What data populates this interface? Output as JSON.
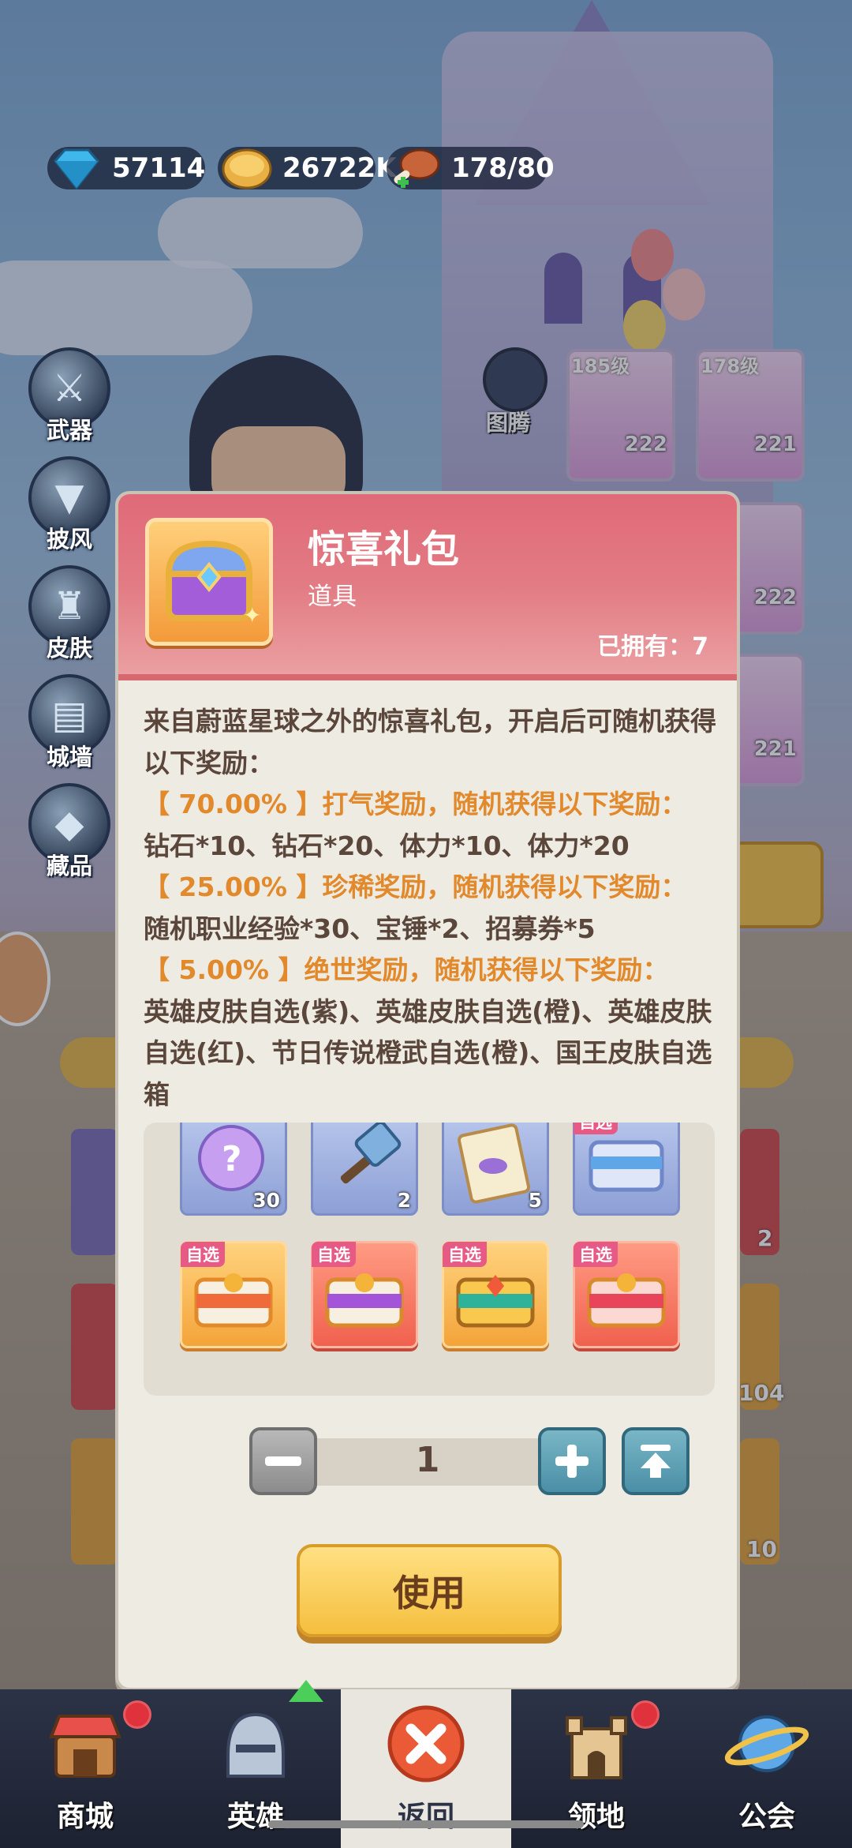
{
  "resources": [
    {
      "icon": "diamond-icon",
      "value": "57114"
    },
    {
      "icon": "coin-icon",
      "value": "26722K"
    },
    {
      "icon": "meat-stamina-icon",
      "value": "178/80"
    }
  ],
  "side_menu": [
    {
      "label": "武器",
      "icon": "weapon-icon"
    },
    {
      "label": "披风",
      "icon": "cape-icon"
    },
    {
      "label": "皮肤",
      "icon": "skin-icon"
    },
    {
      "label": "城墙",
      "icon": "wall-icon"
    },
    {
      "label": "藏品",
      "icon": "collection-icon"
    }
  ],
  "background": {
    "totem_label": "图腾",
    "cards": [
      {
        "level": "185级",
        "number": "222"
      },
      {
        "level": "178级",
        "number": "221"
      },
      {
        "level": "",
        "number": "222"
      },
      {
        "level": "",
        "number": "221"
      }
    ],
    "side_numbers": [
      "2",
      "104",
      "10"
    ]
  },
  "modal": {
    "title": "惊喜礼包",
    "subtitle": "道具",
    "owned_label": "已拥有：",
    "owned_count": "7",
    "description": {
      "intro": "来自蔚蓝星球之外的惊喜礼包，开启后可随机获得以下奖励：",
      "tier1_head": "【 70.00% 】打气奖励，随机获得以下奖励：",
      "tier1_body": "钻石*10、钻石*20、体力*10、体力*20",
      "tier2_head": "【 25.00% 】珍稀奖励，随机获得以下奖励：",
      "tier2_body": "随机职业经验*30、宝锤*2、招募券*5",
      "tier3_head": "【 5.00% 】绝世奖励，随机获得以下奖励：",
      "tier3_body": "英雄皮肤自选(紫)、英雄皮肤自选(橙)、英雄皮肤自选(红)、节日传说橙武自选(橙)、国王皮肤自选箱"
    },
    "rewards_row1": [
      {
        "icon": "mystery-orb-icon",
        "count": "30"
      },
      {
        "icon": "hammer-icon",
        "count": "2"
      },
      {
        "icon": "recruit-ticket-icon",
        "count": "5"
      },
      {
        "icon": "blue-chest-icon",
        "tag": "自选"
      }
    ],
    "rewards_row2": [
      {
        "icon": "orange-chest-icon",
        "tag": "自选"
      },
      {
        "icon": "purple-chest-icon",
        "tag": "自选"
      },
      {
        "icon": "gold-chest-icon",
        "tag": "自选"
      },
      {
        "icon": "red-chest-icon",
        "tag": "自选"
      }
    ],
    "quantity": "1",
    "use_label": "使用"
  },
  "nav": [
    {
      "label": "商城",
      "icon": "shop-icon",
      "badge": true
    },
    {
      "label": "英雄",
      "icon": "hero-helmet-icon",
      "badge": false
    },
    {
      "label": "返回",
      "icon": "close-icon",
      "active": true
    },
    {
      "label": "领地",
      "icon": "castle-icon",
      "badge": true
    },
    {
      "label": "公会",
      "icon": "planet-icon",
      "badge": false
    }
  ],
  "colors": {
    "modal_header": "#e06a78",
    "highlight_text": "#e2892c",
    "body_text": "#5a463a",
    "use_button": "#f5bf3e"
  }
}
